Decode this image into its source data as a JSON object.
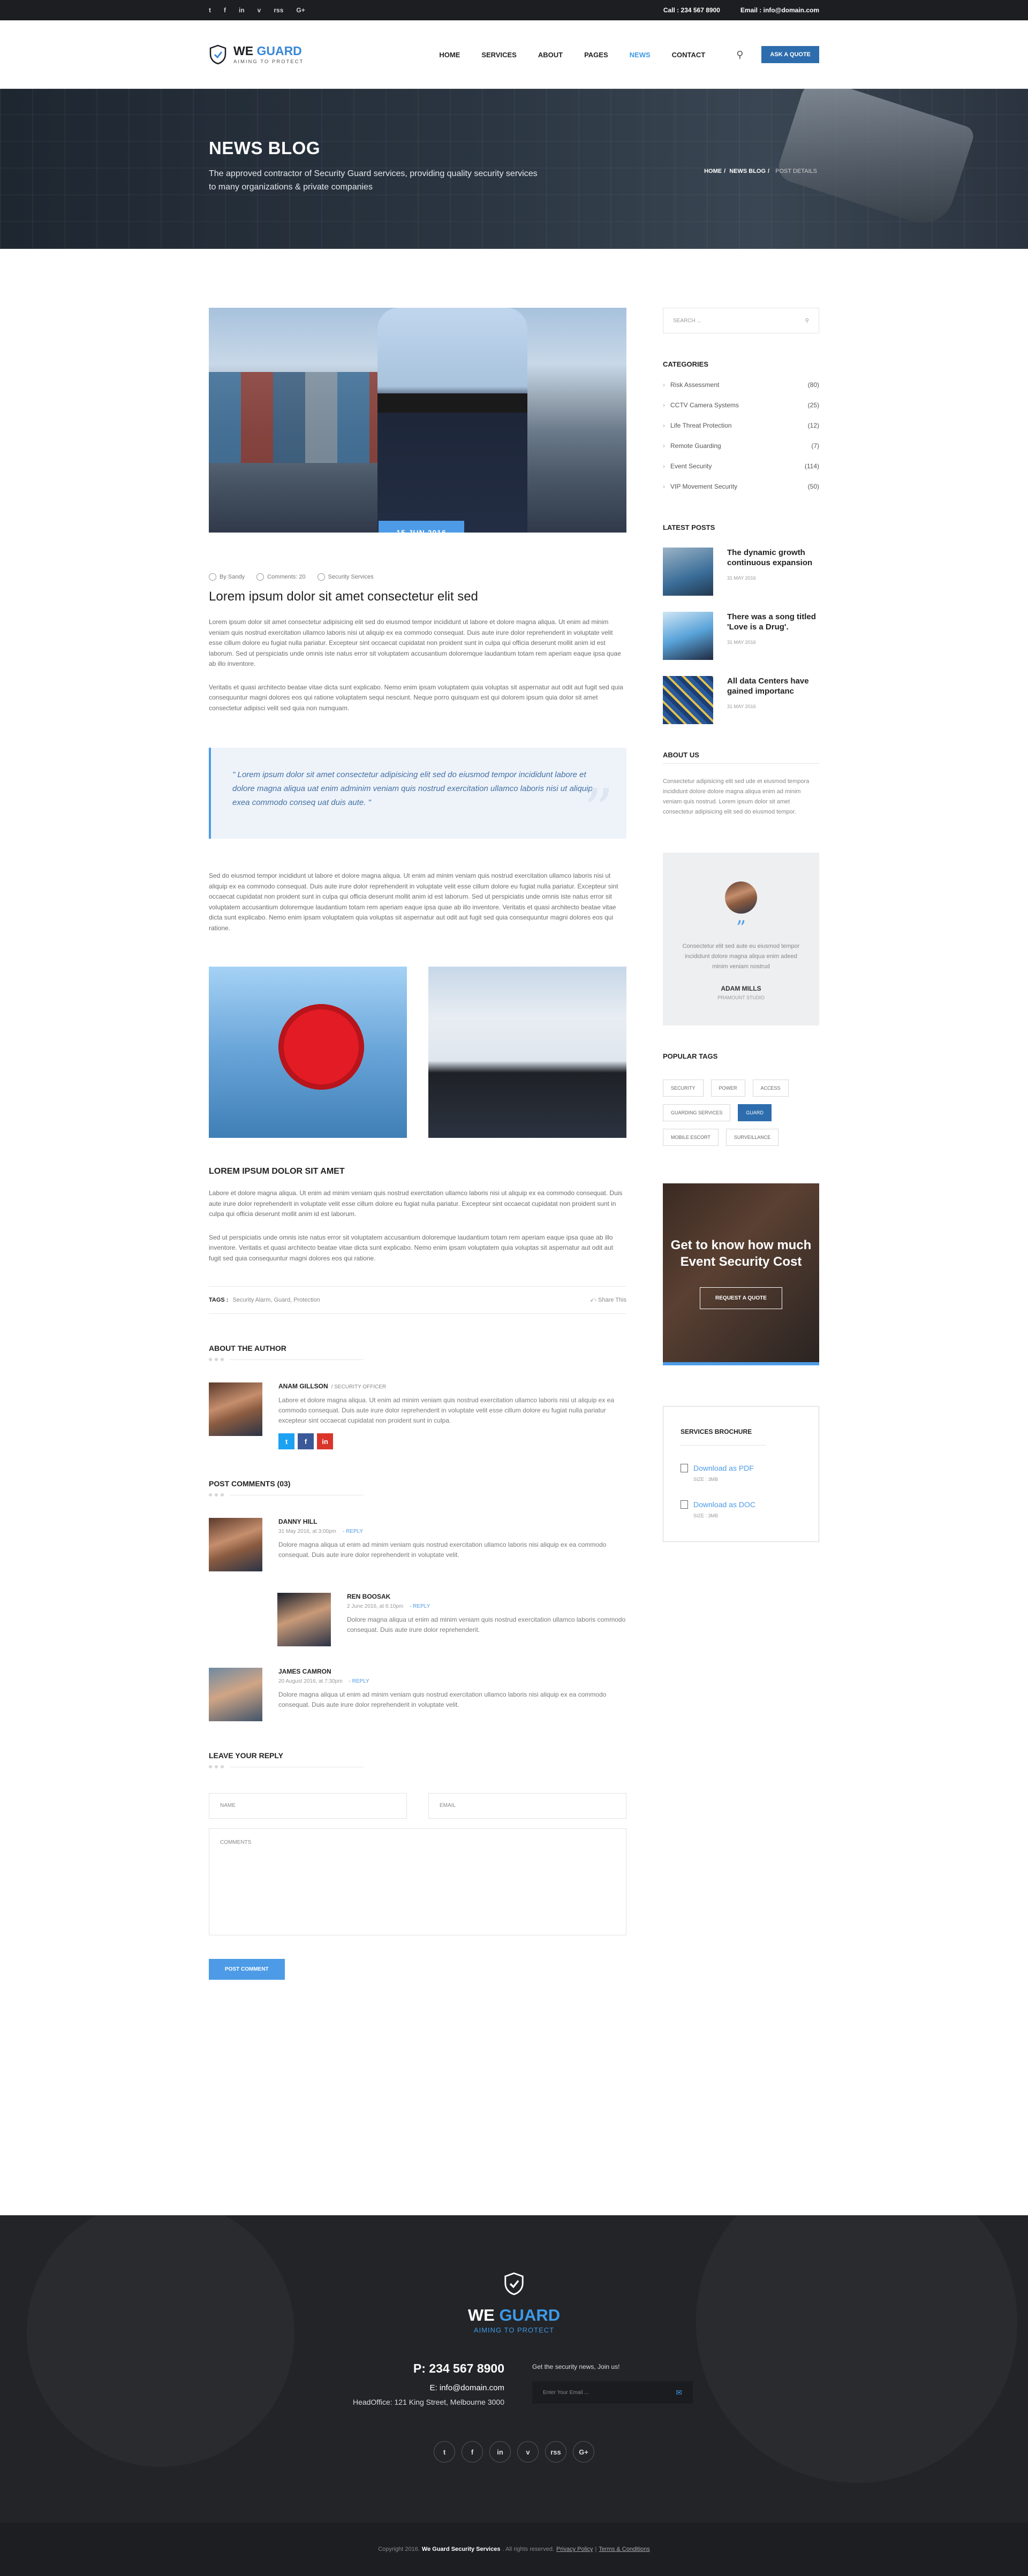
{
  "topbar": {
    "social_icons": [
      "twitter-icon",
      "facebook-icon",
      "linkedin-icon",
      "vimeo-icon",
      "rss-icon",
      "google-plus-icon"
    ],
    "social_glyphs": [
      "t",
      "f",
      "in",
      "v",
      "rss",
      "G+"
    ],
    "call_label": "Call :",
    "call_value": "234 567 8900",
    "email_label": "Email :",
    "email_value": "info@domain.com"
  },
  "header": {
    "logo_we": "WE",
    "logo_guard": "GUARD",
    "logo_tagline": "AIMING TO PROTECT",
    "menu": [
      "HOME",
      "SERVICES",
      "ABOUT",
      "PAGES",
      "NEWS",
      "CONTACT"
    ],
    "active_menu": "NEWS",
    "quote_button": "ASK A QUOTE"
  },
  "banner": {
    "title": "NEWS BLOG",
    "subtitle": "The approved contractor of Security Guard services, providing quality security services to many organizations & private companies",
    "breadcrumb": [
      "HOME",
      "NEWS BLOG",
      "POST DETAILS"
    ]
  },
  "post": {
    "date": "15 JUN 2016",
    "meta_author": "By Sandy",
    "meta_comments": "Comments: 20",
    "meta_category": "Security Services",
    "title": "Lorem ipsum dolor sit amet consectetur elit sed",
    "para1": "Lorem ipsum dolor sit amet consectetur adipisicing elit sed do eiusmod tempor incididunt ut labore et dolore magna aliqua. Ut enim ad minim veniam quis nostrud exercitation ullamco laboris nisi ut aliquip ex ea commodo consequat. Duis aute irure dolor reprehenderit in voluptate velit esse cillum dolore eu fugiat nulla pariatur. Excepteur sint occaecat cupidatat non proident sunt in culpa qui officia deserunt mollit anim id est laborum. Sed ut perspiciatis unde omnis iste natus error sit voluptatem accusantium doloremque laudantium totam rem aperiam eaque ipsa quae ab illo inventore.",
    "para2": "Veritatis et quasi architecto beatae vitae dicta sunt explicabo. Nemo enim ipsam voluptatem quia voluptas sit aspernatur aut odit aut fugit sed quia consequuntur magni dolores eos qui ratione voluptatem sequi nesciunt. Neque porro quisquam est qui dolorem ipsum quia dolor sit amet consectetur adipisci velit sed quia non numquam.",
    "quote": "\" Lorem ipsum dolor sit amet consectetur adipisicing elit sed do eiusmod tempor incididunt labore et dolore magna aliqua uat enim adminim veniam quis nostrud exercitation ullamco laboris nisi ut aliquip exea commodo conseq uat duis aute. \"",
    "para3": "Sed do eiusmod tempor incididunt ut labore et dolore magna aliqua. Ut enim ad minim veniam quis nostrud exercitation ullamco laboris nisi ut aliquip ex ea commodo consequat. Duis aute irure dolor reprehenderit in voluptate velit esse cillum dolore eu fugiat nulla pariatur. Excepteur sint occaecat cupidatat non proident sunt in culpa qui officia deserunt mollit anim id est laborum. Sed ut perspiciatis unde omnis iste natus error sit voluptatem accusantium doloremque laudantium totam rem aperiam eaque ipsa quae ab illo inventore. Veritatis et quasi architecto beatae vitae dicta sunt explicabo. Nemo enim ipsam voluptatem quia voluptas sit aspernatur aut odit aut fugit sed quia consequuntur magni dolores eos qui ratione.",
    "subheading": "LOREM IPSUM DOLOR SIT AMET",
    "para4": "Labore et dolore magna aliqua. Ut enim ad minim veniam quis nostrud exercitation ullamco laboris nisi ut aliquip ex ea commodo consequat. Duis aute irure dolor reprehenderit in voluptate velit esse cillum dolore eu fugiat nulla pariatur. Excepteur sint occaecat cupidatat non proident sunt in culpa qui officia deserunt mollit anim id est laborum.",
    "para5": "Sed ut perspiciatis unde omnis iste natus error sit voluptatem accusantium doloremque laudantium totam rem aperiam eaque ipsa quae ab illo inventore. Veritatis et quasi architecto beatae vitae dicta sunt explicabo. Nemo enim ipsam voluptatem quia voluptas sit aspernatur aut odit aut fugit sed quia consequuntur magni dolores eos qui ratione.",
    "tags_label": "TAGS :",
    "tags": "Security Alarm, Guard, Protection",
    "share": "Share This"
  },
  "author": {
    "heading": "ABOUT THE AUTHOR",
    "name": "ANAM GILLSON",
    "role": "/ SECURITY OFFICER",
    "bio": "Labore et dolore magna aliqua. Ut enim ad minim veniam quis nostrud exercitation ullamco laboris nisi ut aliquip ex ea commodo consequat. Duis aute irure dolor reprehenderit in voluptate velit esse cillum dolore eu fugiat nulla pariatur excepteur sint occaecat cupidatat non proident sunt in culpa.",
    "social_glyphs": [
      "t",
      "f",
      "in"
    ],
    "social_colors": [
      "#1da1f2",
      "#3b5998",
      "#d9352b"
    ]
  },
  "comments": {
    "heading": "POST COMMENTS (03)",
    "reply_label": "- REPLY",
    "items": [
      {
        "name": "DANNY HILL",
        "date": "31 May 2016, at 3:00pm",
        "body": "Dolore magna aliqua ut enim ad minim veniam quis nostrud exercitation ullamco laboris nisi aliquip ex ea commodo consequat. Duis aute irure dolor reprehenderit in voluptate velit."
      },
      {
        "name": "REN BOOSAK",
        "date": "2 June 2016, at 6:10pm",
        "body": "Dolore magna aliqua ut enim ad minim veniam quis nostrud exercitation ullamco laboris commodo consequat. Duis aute irure dolor reprehenderit."
      },
      {
        "name": "JAMES CAMRON",
        "date": "20 August 2016, at 7:30pm",
        "body": "Dolore magna aliqua ut enim ad minim veniam quis nostrud exercitation ullamco laboris nisi aliquip ex ea commodo consequat. Duis aute irure dolor reprehenderit in voluptate velit."
      }
    ]
  },
  "reply_form": {
    "heading": "LEAVE YOUR REPLY",
    "name_placeholder": "NAME",
    "email_placeholder": "EMAIL",
    "comments_placeholder": "COMMENTS",
    "submit": "POST COMMENT"
  },
  "sidebar": {
    "search_placeholder": "SEARCH ...",
    "categories_heading": "CATEGORIES",
    "categories": [
      {
        "name": "Risk Assessment",
        "count": "(80)"
      },
      {
        "name": "CCTV Camera Systems",
        "count": "(25)"
      },
      {
        "name": "Life Threat Protection",
        "count": "(12)"
      },
      {
        "name": "Remote Guarding",
        "count": "(7)"
      },
      {
        "name": "Event Security",
        "count": "(114)"
      },
      {
        "name": "VIP Movement Security",
        "count": "(50)"
      }
    ],
    "latest_heading": "LATEST POSTS",
    "latest": [
      {
        "title": "The dynamic growth continuous expansion",
        "date": "31 MAY 2016"
      },
      {
        "title": "There was a song titled 'Love is a Drug'.",
        "date": "31 MAY 2016"
      },
      {
        "title": "All data Centers have gained importanc",
        "date": "31 MAY 2016"
      }
    ],
    "about_heading": "ABOUT US",
    "about_text": "Consectetur adipisicing elit sed ude et eiusmod tempora incididunt dolore dolore magna aliqua enim ad minim veniam quis nostrud. Lorem ipsum dolor sit amet consectetur adipisicing elit sed do eiusmod tempor.",
    "testimonial_text": "Consectetur elit sed aute eu eiusmod tempor incididunt dolore magna aliqua enim adeed minim veniam nostrud",
    "testimonial_name": "ADAM MILLS",
    "testimonial_company": "PRAMOUNT STUDIO",
    "tags_heading": "POPULAR TAGS",
    "tags": [
      "SECURITY",
      "POWER",
      "ACCESS",
      "GUARDING SERVICES",
      "GUARD",
      "MOBILE ESCORT",
      "SURVEILLANCE"
    ],
    "active_tag": "GUARD",
    "promo_title": "Get to know how much Event Security Cost",
    "promo_button": "REQUEST A QUOTE",
    "brochure_heading": "SERVICES BROCHURE",
    "downloads": [
      {
        "label": "Download as PDF",
        "size": "SIZE : 3MB"
      },
      {
        "label": "Download as DOC",
        "size": "SIZE : 3MB"
      }
    ]
  },
  "footer": {
    "logo_we": "WE",
    "logo_guard": "GUARD",
    "tagline": "AIMING TO PROTECT",
    "phone": "P: 234 567 8900",
    "email": "E: info@domain.com",
    "address": "HeadOffice: 121 King Street, Melbourne 3000",
    "newsletter_text": "Get the security news, Join us!",
    "newsletter_placeholder": "Enter Your Email ...",
    "social_glyphs": [
      "t",
      "f",
      "in",
      "v",
      "rss",
      "G+"
    ],
    "social_icons": [
      "twitter-icon",
      "facebook-icon",
      "linkedin-icon",
      "vimeo-icon",
      "rss-icon",
      "google-plus-icon"
    ],
    "copyright": "Copyright 2016.",
    "brand": "We Guard Security Services",
    "rights": ". All rights reserved.",
    "privacy": "Privacy Policy",
    "terms": "Terms & Conditions"
  }
}
